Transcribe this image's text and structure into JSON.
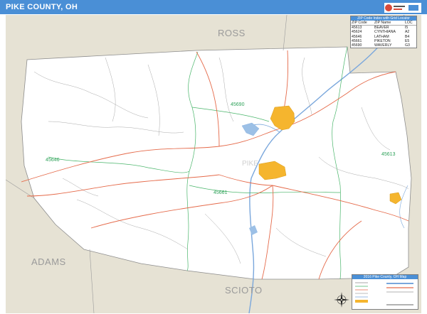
{
  "title": "PIKE COUNTY, OH",
  "neighbors": {
    "north": "ROSS",
    "southwest": "ADAMS",
    "south": "SCIOTO"
  },
  "county_label": "PIKE",
  "zip_labels": [
    "45690",
    "45613",
    "45646",
    "45661"
  ],
  "zip_table": {
    "header": "ZIP Code Index with Grid Locator",
    "columns": [
      "ZIP Code",
      "ZIP Name",
      "LOC"
    ],
    "rows": [
      [
        "45613",
        "BEAVER",
        "I5"
      ],
      [
        "45624",
        "CYNTHIANA",
        "A2"
      ],
      [
        "45646",
        "LATHAM",
        "B4"
      ],
      [
        "45661",
        "PIKETON",
        "E5"
      ],
      [
        "45690",
        "WAVERLY",
        "G3"
      ]
    ]
  },
  "legend": {
    "header": "2016 Pike County, OH Map"
  },
  "colors": {
    "title_bar": "#4a8fd6",
    "county_fill": "#ffffff",
    "neighbor_fill": "#e6e2d4",
    "city_fill": "#f5b52e",
    "water": "#7aa7dc",
    "road_major": "#e56a4a",
    "road_minor": "#a9a9a9",
    "zip_boundary": "#49b56a",
    "county_boundary": "#8c8c8c"
  }
}
